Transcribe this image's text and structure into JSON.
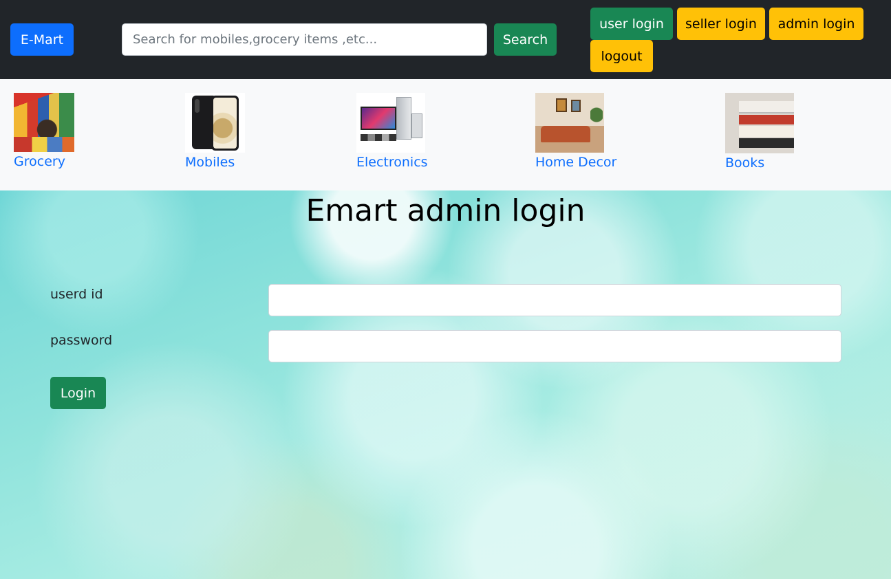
{
  "navbar": {
    "brand_label": "E-Mart",
    "search": {
      "placeholder": "Search for mobiles,grocery items ,etc...",
      "value": "",
      "button_label": "Search"
    },
    "buttons": {
      "user_login": "user login",
      "seller_login": "seller login",
      "admin_login": "admin login",
      "logout": "logout"
    }
  },
  "categories": [
    {
      "label": "Grocery",
      "icon": "grocery-image"
    },
    {
      "label": "Mobiles",
      "icon": "mobiles-image"
    },
    {
      "label": "Electronics",
      "icon": "electronics-image"
    },
    {
      "label": "Home Decor",
      "icon": "home-decor-image"
    },
    {
      "label": "Books",
      "icon": "books-image"
    }
  ],
  "login": {
    "title": "Emart admin login",
    "userid_label": "userd id",
    "userid_value": "",
    "password_label": "password",
    "password_value": "",
    "submit_label": "Login"
  },
  "colors": {
    "navbar_bg": "#212529",
    "primary": "#0d6efd",
    "success": "#198754",
    "warning": "#ffc107",
    "category_bg": "#f8f9fa"
  }
}
